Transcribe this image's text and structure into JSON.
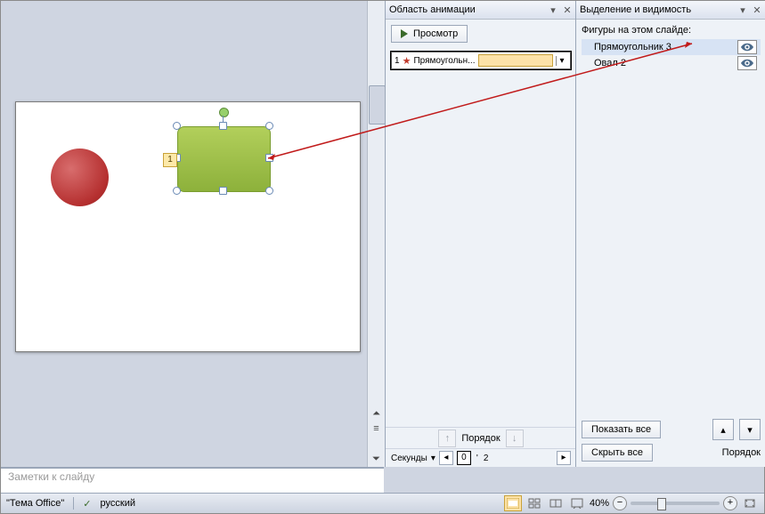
{
  "editor": {
    "shapes": {
      "anim_tag": "1"
    }
  },
  "anim_pane": {
    "title": "Область анимации",
    "preview": "Просмотр",
    "items": [
      {
        "index": "1",
        "name": "Прямоугольн..."
      }
    ],
    "timeline_label": "Секунды",
    "timeline_marks": [
      "0",
      "2"
    ],
    "order_label": "Порядок"
  },
  "sel_pane": {
    "title": "Выделение и видимость",
    "header": "Фигуры на этом слайде:",
    "items": [
      {
        "name": "Прямоугольник 3",
        "active": true
      },
      {
        "name": "Овал 2",
        "active": false
      }
    ],
    "show_all": "Показать все",
    "hide_all": "Скрыть все",
    "order_label": "Порядок"
  },
  "notes": "Заметки к слайду",
  "status": {
    "theme": "\"Тема Office\"",
    "lang": "русский",
    "zoom": "40%"
  }
}
